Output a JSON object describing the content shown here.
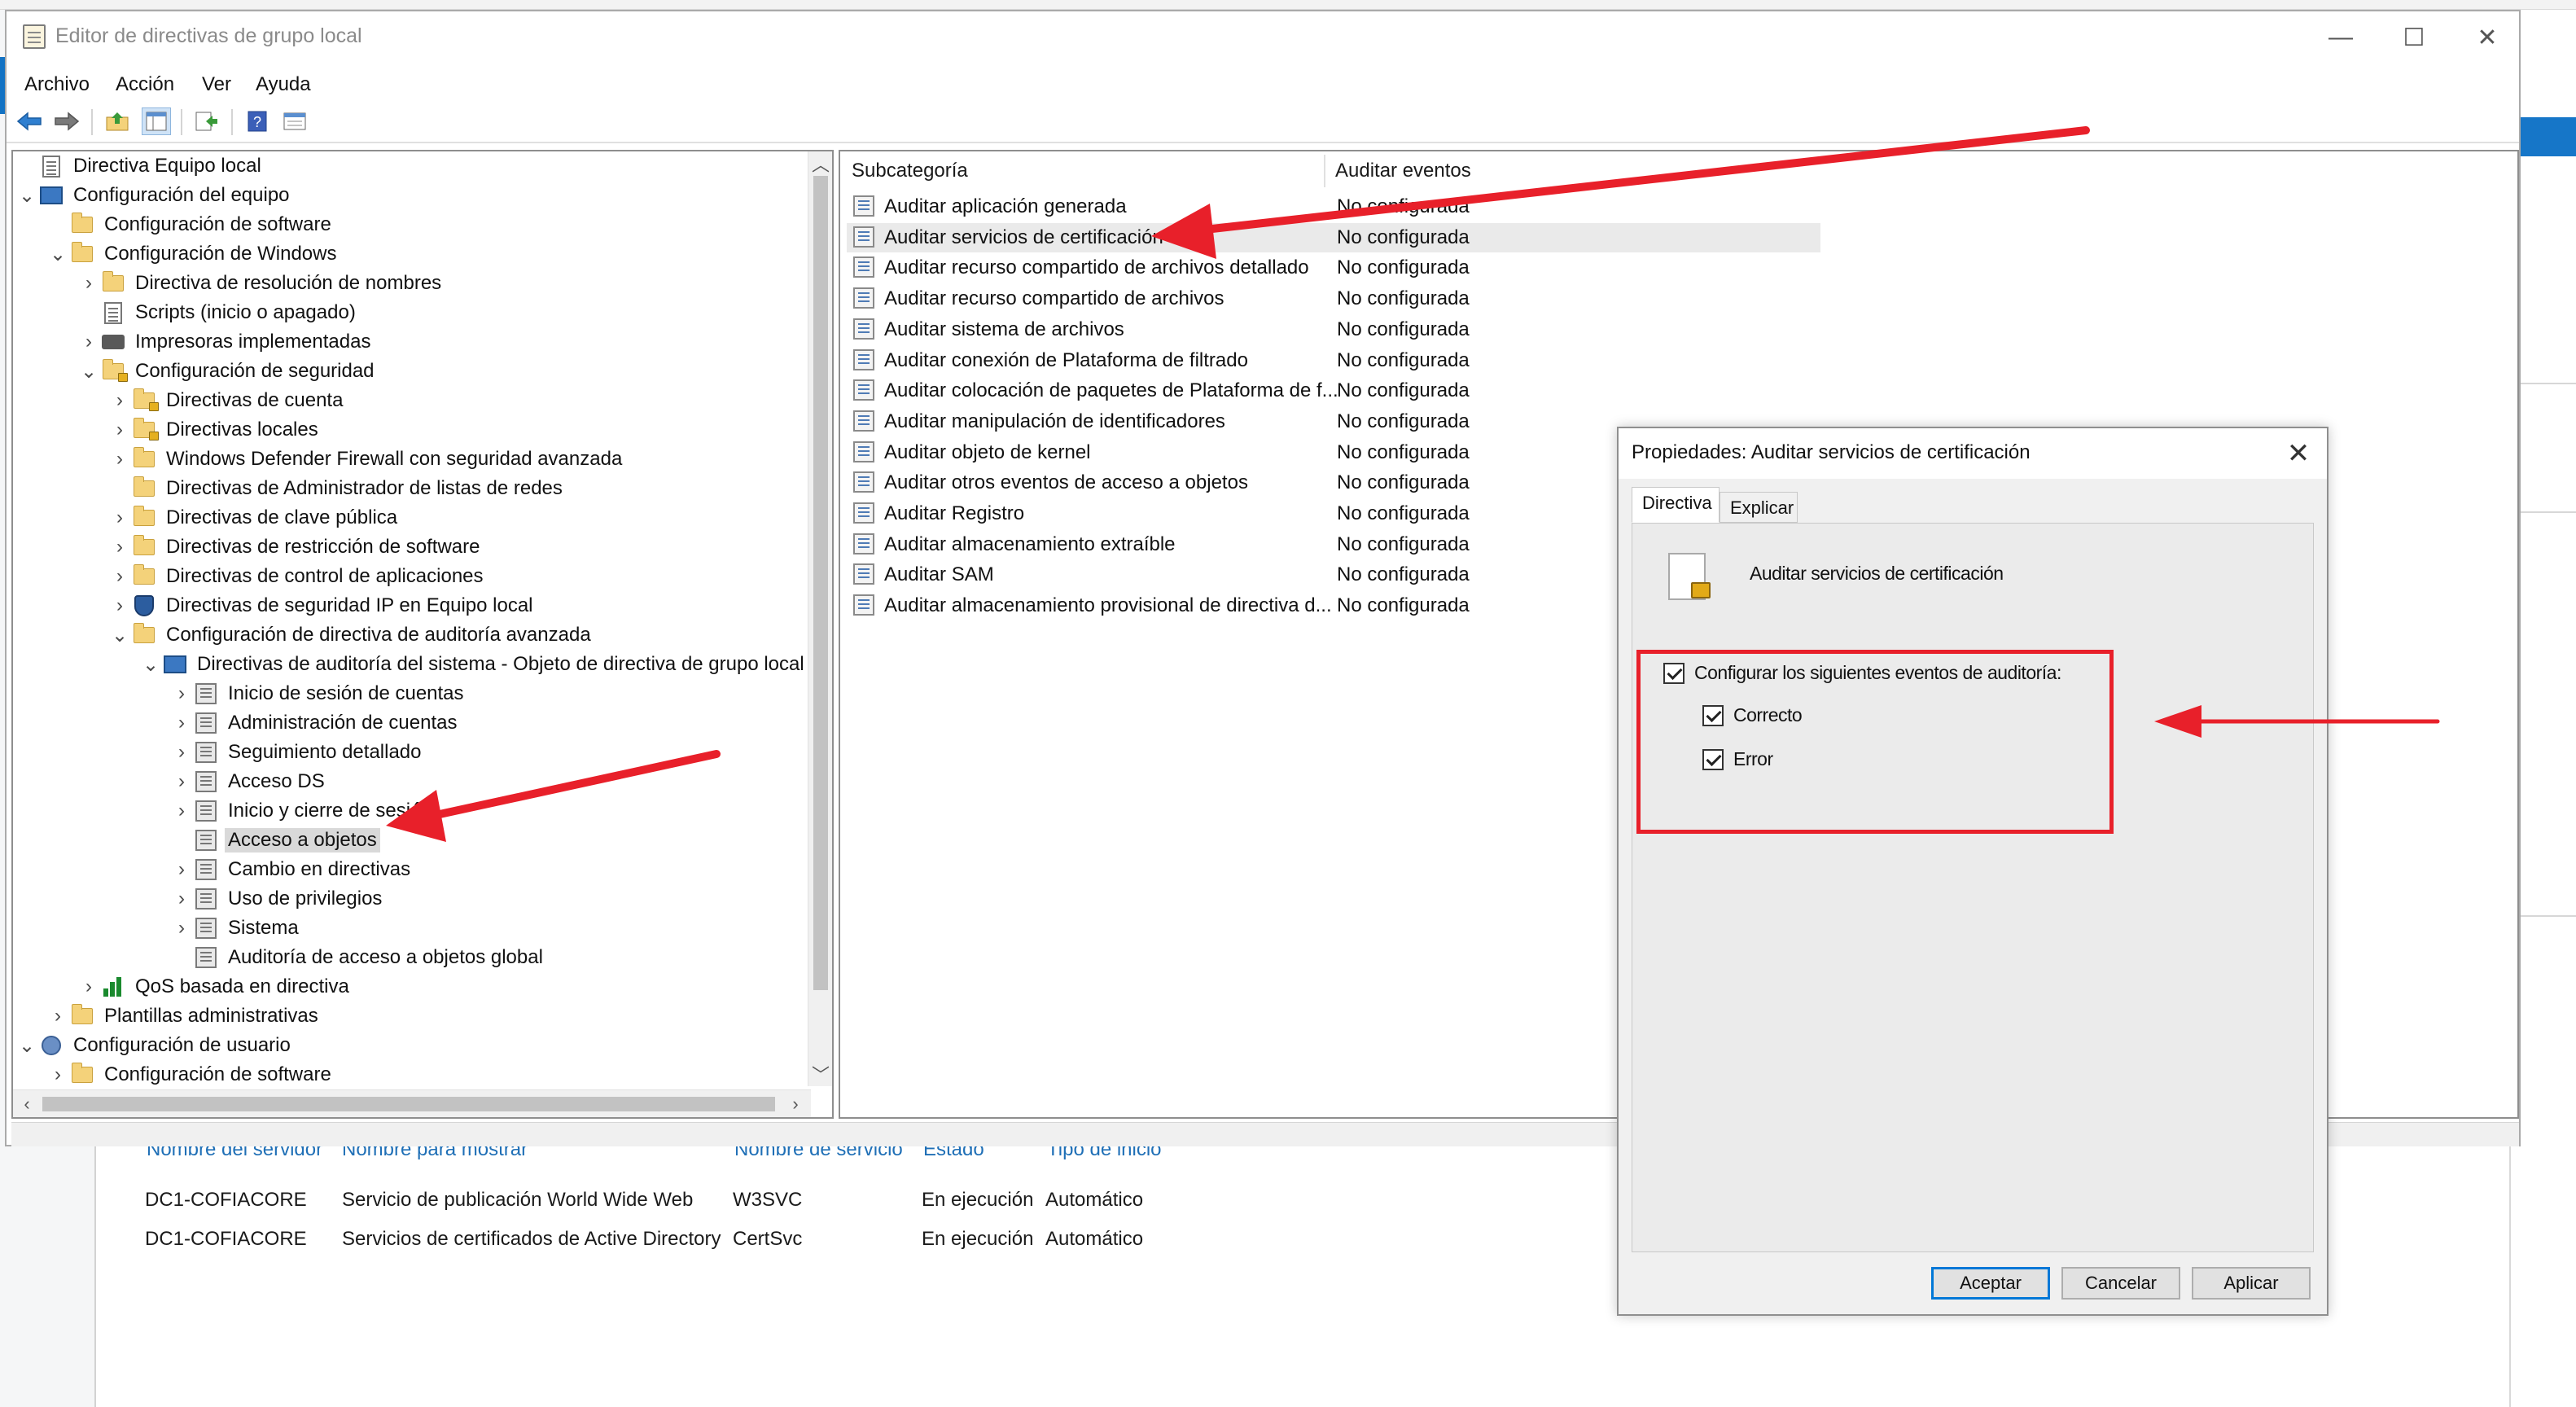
{
  "window": {
    "title": "Editor de directivas de grupo local",
    "controls": [
      "—",
      "☐",
      "✕"
    ]
  },
  "menu": [
    "Archivo",
    "Acción",
    "Ver",
    "Ayuda"
  ],
  "toolbar": {
    "icons": [
      "back-arrow-icon",
      "forward-arrow-icon",
      "up-folder-icon",
      "show-hide-tree-icon",
      "export-list-icon",
      "help-icon",
      "properties-view-icon"
    ]
  },
  "tree": {
    "items": [
      {
        "label": "Directiva Equipo local",
        "level": 0,
        "exp": "",
        "icon": "doc"
      },
      {
        "label": "Configuración del equipo",
        "level": 0,
        "exp": "v",
        "icon": "pc"
      },
      {
        "label": "Configuración de software",
        "level": 1,
        "exp": "",
        "icon": "folder"
      },
      {
        "label": "Configuración de Windows",
        "level": 1,
        "exp": "v",
        "icon": "folder"
      },
      {
        "label": "Directiva de resolución de nombres",
        "level": 2,
        "exp": ">",
        "icon": "folder"
      },
      {
        "label": "Scripts (inicio o apagado)",
        "level": 2,
        "exp": "",
        "icon": "doc"
      },
      {
        "label": "Impresoras implementadas",
        "level": 2,
        "exp": ">",
        "icon": "printer"
      },
      {
        "label": "Configuración de seguridad",
        "level": 2,
        "exp": "v",
        "icon": "folder-lock"
      },
      {
        "label": "Directivas de cuenta",
        "level": 3,
        "exp": ">",
        "icon": "folder-lock"
      },
      {
        "label": "Directivas locales",
        "level": 3,
        "exp": ">",
        "icon": "folder-lock"
      },
      {
        "label": "Windows Defender Firewall con seguridad avanzada",
        "level": 3,
        "exp": ">",
        "icon": "folder"
      },
      {
        "label": "Directivas de Administrador de listas de redes",
        "level": 3,
        "exp": "",
        "icon": "folder"
      },
      {
        "label": "Directivas de clave pública",
        "level": 3,
        "exp": ">",
        "icon": "folder"
      },
      {
        "label": "Directivas de restricción de software",
        "level": 3,
        "exp": ">",
        "icon": "folder"
      },
      {
        "label": "Directivas de control de aplicaciones",
        "level": 3,
        "exp": ">",
        "icon": "folder"
      },
      {
        "label": "Directivas de seguridad IP en Equipo local",
        "level": 3,
        "exp": ">",
        "icon": "shield"
      },
      {
        "label": "Configuración de directiva de auditoría avanzada",
        "level": 3,
        "exp": "v",
        "icon": "folder"
      },
      {
        "label": "Directivas de auditoría del sistema - Objeto de directiva de grupo local",
        "level": 4,
        "exp": "v",
        "icon": "pc"
      },
      {
        "label": "Inicio de sesión de cuentas",
        "level": 5,
        "exp": ">",
        "icon": "audit"
      },
      {
        "label": "Administración de cuentas",
        "level": 5,
        "exp": ">",
        "icon": "audit"
      },
      {
        "label": "Seguimiento detallado",
        "level": 5,
        "exp": ">",
        "icon": "audit"
      },
      {
        "label": "Acceso DS",
        "level": 5,
        "exp": ">",
        "icon": "audit"
      },
      {
        "label": "Inicio y cierre de sesión",
        "level": 5,
        "exp": ">",
        "icon": "audit"
      },
      {
        "label": "Acceso a objetos",
        "level": 5,
        "exp": "",
        "icon": "audit",
        "selected": true
      },
      {
        "label": "Cambio en directivas",
        "level": 5,
        "exp": ">",
        "icon": "audit"
      },
      {
        "label": "Uso de privilegios",
        "level": 5,
        "exp": ">",
        "icon": "audit"
      },
      {
        "label": "Sistema",
        "level": 5,
        "exp": ">",
        "icon": "audit"
      },
      {
        "label": "Auditoría de acceso a objetos global",
        "level": 5,
        "exp": "",
        "icon": "audit"
      },
      {
        "label": "QoS basada en directiva",
        "level": 2,
        "exp": ">",
        "icon": "bars"
      },
      {
        "label": "Plantillas administrativas",
        "level": 1,
        "exp": ">",
        "icon": "folder"
      },
      {
        "label": "Configuración de usuario",
        "level": 0,
        "exp": "v",
        "icon": "user"
      },
      {
        "label": "Configuración de software",
        "level": 1,
        "exp": ">",
        "icon": "folder"
      }
    ]
  },
  "list": {
    "headers": [
      "Subcategoría",
      "Auditar eventos"
    ],
    "rows": [
      {
        "name": "Auditar aplicación generada",
        "value": "No configurada"
      },
      {
        "name": "Auditar servicios de certificación",
        "value": "No configurada",
        "highlight": true
      },
      {
        "name": "Auditar recurso compartido de archivos detallado",
        "value": "No configurada"
      },
      {
        "name": "Auditar recurso compartido de archivos",
        "value": "No configurada"
      },
      {
        "name": "Auditar sistema de archivos",
        "value": "No configurada"
      },
      {
        "name": "Auditar conexión de Plataforma de filtrado",
        "value": "No configurada"
      },
      {
        "name": "Auditar colocación de paquetes de Plataforma de f...",
        "value": "No configurada"
      },
      {
        "name": "Auditar manipulación de identificadores",
        "value": "No configurada"
      },
      {
        "name": "Auditar objeto de kernel",
        "value": "No configurada"
      },
      {
        "name": "Auditar otros eventos de acceso a objetos",
        "value": "No configurada"
      },
      {
        "name": "Auditar Registro",
        "value": "No configurada"
      },
      {
        "name": "Auditar almacenamiento extraíble",
        "value": "No configurada"
      },
      {
        "name": "Auditar SAM",
        "value": "No configurada"
      },
      {
        "name": "Auditar almacenamiento provisional de directiva d...",
        "value": "No configurada"
      }
    ]
  },
  "dialog": {
    "title": "Propiedades: Auditar servicios de certificación",
    "close": "✕",
    "tabs": [
      "Directiva",
      "Explicar"
    ],
    "policy_name": "Auditar servicios de certificación",
    "configure_label": "Configurar los siguientes eventos de auditoría:",
    "success_label": "Correcto",
    "failure_label": "Error",
    "configure_checked": true,
    "success_checked": true,
    "failure_checked": true,
    "buttons": {
      "ok": "Aceptar",
      "cancel": "Cancelar",
      "apply": "Aplicar"
    }
  },
  "background_services": {
    "headers": [
      "Nombre del servidor",
      "Nombre para mostrar",
      "Nombre de servicio",
      "Estado",
      "Tipo de inicio"
    ],
    "rows": [
      [
        "DC1-COFIACORE",
        "Servicio de publicación World Wide Web",
        "W3SVC",
        "En ejecución",
        "Automático"
      ],
      [
        "DC1-COFIACORE",
        "Servicios de certificados de Active Directory",
        "CertSvc",
        "En ejecución",
        "Automático"
      ]
    ]
  },
  "colors": {
    "annotation_red": "#e8202a",
    "accent_blue": "#0078d7",
    "header_link_blue": "#1f6fb6"
  }
}
